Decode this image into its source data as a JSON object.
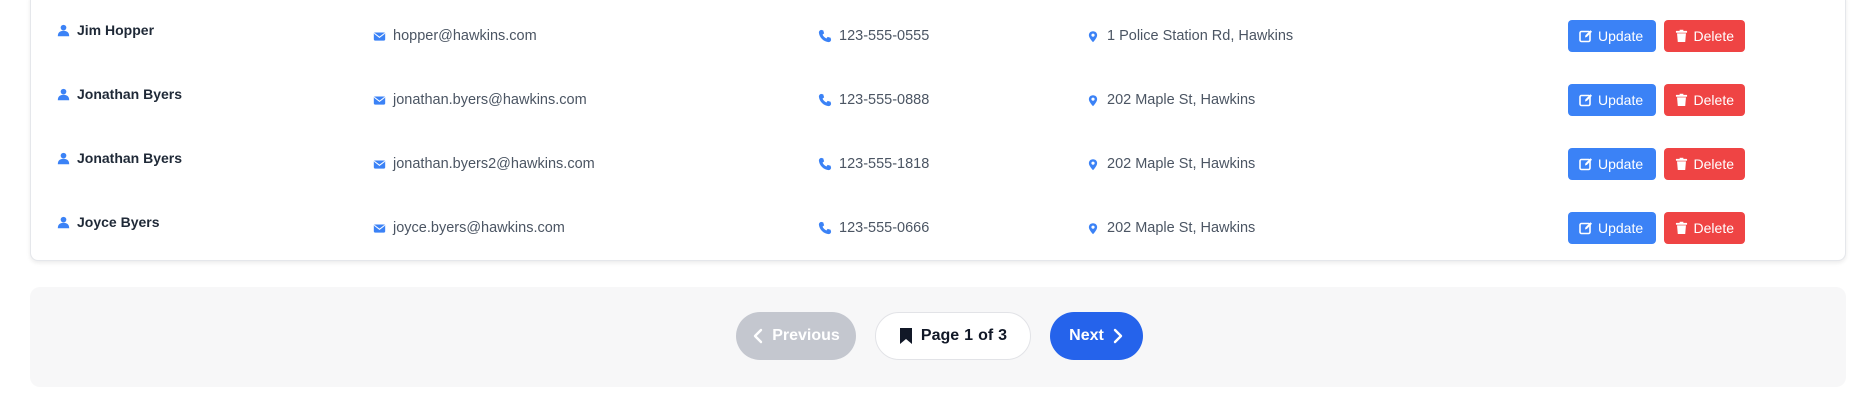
{
  "rows": [
    {
      "name": "Jim Hopper",
      "email": "hopper@hawkins.com",
      "phone": "123-555-0555",
      "address": "1 Police Station Rd, Hawkins"
    },
    {
      "name": "Jonathan Byers",
      "email": "jonathan.byers@hawkins.com",
      "phone": "123-555-0888",
      "address": "202 Maple St, Hawkins"
    },
    {
      "name": "Jonathan Byers",
      "email": "jonathan.byers2@hawkins.com",
      "phone": "123-555-1818",
      "address": "202 Maple St, Hawkins"
    },
    {
      "name": "Joyce Byers",
      "email": "joyce.byers@hawkins.com",
      "phone": "123-555-0666",
      "address": "202 Maple St, Hawkins"
    }
  ],
  "actions": {
    "update_label": "Update",
    "delete_label": "Delete"
  },
  "pagination": {
    "previous_label": "Previous",
    "next_label": "Next",
    "page_word": "Page",
    "current_page": "1",
    "of_word": "of",
    "total_pages": "3"
  },
  "icons": {
    "name": "user-icon",
    "email": "envelope-icon",
    "phone": "phone-icon",
    "address": "map-marker-icon",
    "update": "edit-icon",
    "delete": "trash-icon",
    "previous": "chevron-left-icon",
    "next": "chevron-right-icon",
    "page": "bookmark-icon"
  },
  "colors": {
    "icon_blue": "#3b82f6",
    "update_bg": "#3b82f6",
    "delete_bg": "#ef4444",
    "next_bg": "#2563eb",
    "previous_disabled_bg": "#c4c7cf"
  }
}
